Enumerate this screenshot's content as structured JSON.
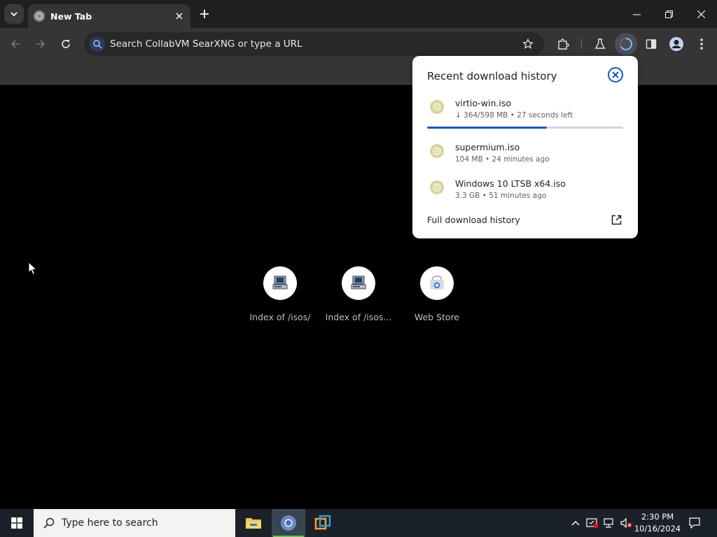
{
  "tabs": [
    {
      "title": "New Tab",
      "active": true
    }
  ],
  "omnibox": {
    "placeholder": "Search CollabVM SearXNG or type a URL"
  },
  "shortcuts": [
    {
      "label": "Index of /isos/",
      "icon": "server-icon"
    },
    {
      "label": "Index of /isos...",
      "icon": "server-icon"
    },
    {
      "label": "Web Store",
      "icon": "web-store-icon"
    }
  ],
  "downloads": {
    "title": "Recent download history",
    "items": [
      {
        "name": "virtio-win.iso",
        "status": "↓ 364/598 MB • 27 seconds left",
        "progress": 0.61,
        "in_progress": true
      },
      {
        "name": "supermium.iso",
        "status": "104 MB • 24 minutes ago",
        "in_progress": false
      },
      {
        "name": "Windows 10 LTSB x64.iso",
        "status": "3.3 GB • 51 minutes ago",
        "in_progress": false
      }
    ],
    "full_history_label": "Full download history"
  },
  "taskbar": {
    "search_placeholder": "Type here to search",
    "apps": [
      {
        "name": "file-explorer",
        "active": false
      },
      {
        "name": "chrome",
        "active": true
      },
      {
        "name": "vmware",
        "active": false
      }
    ],
    "clock": {
      "time": "2:30 PM",
      "date": "10/16/2024"
    }
  },
  "colors": {
    "accent": "#0b57d0",
    "progress_track": "#d0d7e3",
    "tab_active_bg": "#353535",
    "taskbar_bg": "#1b2128"
  }
}
